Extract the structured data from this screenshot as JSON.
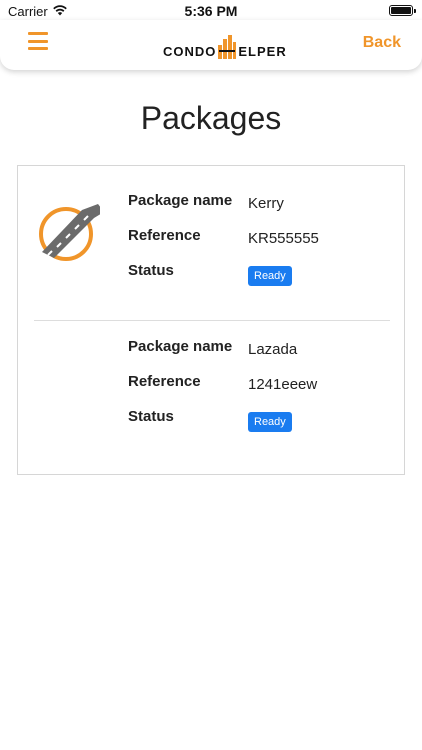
{
  "status_bar": {
    "carrier": "Carrier",
    "time": "5:36 PM",
    "wifi_icon": "wifi-icon",
    "battery_icon": "battery-icon"
  },
  "nav": {
    "menu_icon": "hamburger-menu-icon",
    "logo_left": "CONDO",
    "logo_right": "ELPER",
    "back_label": "Back"
  },
  "page": {
    "title": "Packages"
  },
  "labels": {
    "package_name": "Package name",
    "reference": "Reference",
    "status": "Status"
  },
  "packages": [
    {
      "name": "Kerry",
      "reference": "KR555555",
      "status": "Ready",
      "thumbnail": "road-icon"
    },
    {
      "name": "Lazada",
      "reference": "1241eeew",
      "status": "Ready",
      "thumbnail": ""
    }
  ],
  "colors": {
    "accent": "#f0952a",
    "badge": "#1a7cf0",
    "road": "#6b6b6b"
  }
}
